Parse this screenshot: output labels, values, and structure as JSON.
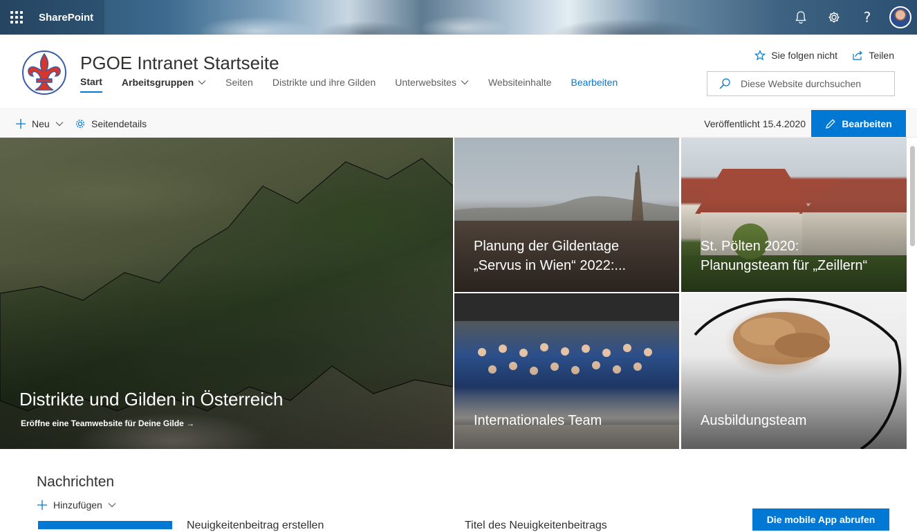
{
  "suite": {
    "brand": "SharePoint",
    "icons": [
      "bell-icon",
      "gear-icon",
      "help-icon"
    ]
  },
  "site": {
    "title": "PGOE Intranet Startseite",
    "follow_label": "Sie folgen nicht",
    "share_label": "Teilen",
    "search_placeholder": "Diese Website durchsuchen",
    "nav": [
      {
        "label": "Start"
      },
      {
        "label": "Arbeitsgruppen"
      },
      {
        "label": "Seiten"
      },
      {
        "label": "Distrikte und ihre Gilden"
      },
      {
        "label": "Unterwebsites"
      },
      {
        "label": "Websiteinhalte"
      },
      {
        "label": "Bearbeiten"
      }
    ]
  },
  "commandbar": {
    "new_label": "Neu",
    "details_label": "Seitendetails",
    "published": "Veröffentlicht 15.4.2020",
    "edit_label": "Bearbeiten"
  },
  "hero": {
    "main": {
      "title": "Distrikte und Gilden in Österreich",
      "link": "Eröffne eine Teamwebsite für Deine Gilde"
    },
    "tiles": [
      {
        "title_line1": "Planung der Gildentage",
        "title_line2": "„Servus in Wien“ 2022:..."
      },
      {
        "title_line1": "St. Pölten 2020:",
        "title_line2": "Planungsteam für „Zeillern“"
      },
      {
        "title": "Internationales Team"
      },
      {
        "title": "Ausbildungsteam"
      }
    ]
  },
  "news": {
    "title": "Nachrichten",
    "add_label": "Hinzufügen",
    "create_label": "Neuigkeitenbeitrag erstellen",
    "headline_placeholder": "Titel des Neuigkeitenbeitrags",
    "mobile_app_label": "Die mobile App abrufen"
  },
  "colors": {
    "accent": "#0078d4",
    "logo_red": "#d6362b",
    "logo_blue": "#3a5ba8"
  }
}
